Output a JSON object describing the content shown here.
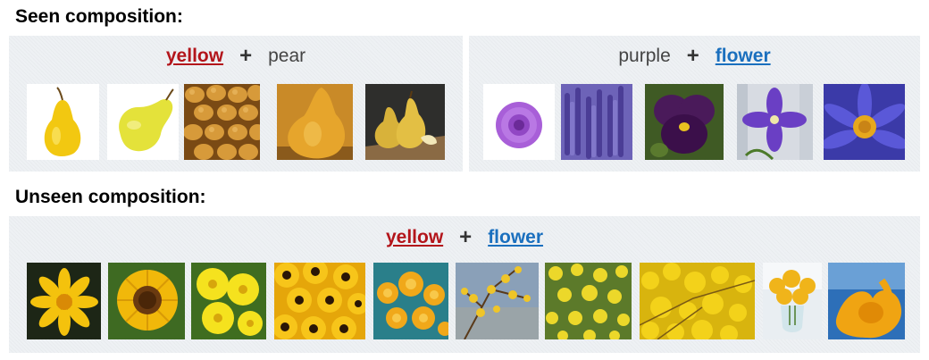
{
  "seen": {
    "title": "Seen composition:",
    "left": {
      "attribute": "yellow",
      "plus": "+",
      "object": "pear",
      "images": [
        "pear-image",
        "pear-image",
        "pear-image",
        "pear-image",
        "pear-image"
      ]
    },
    "right": {
      "attribute": "purple",
      "plus": "+",
      "object": "flower",
      "images": [
        "purple-flower-image",
        "purple-flower-image",
        "purple-flower-image",
        "purple-flower-image",
        "purple-flower-image"
      ]
    }
  },
  "unseen": {
    "title": "Unseen composition:",
    "attribute": "yellow",
    "plus": "+",
    "object": "flower",
    "images": [
      "yellow-flower-image",
      "yellow-flower-image",
      "yellow-flower-image",
      "yellow-flower-image",
      "yellow-flower-image",
      "yellow-flower-image",
      "yellow-flower-image",
      "yellow-flower-image",
      "yellow-flower-image",
      "yellow-flower-image"
    ]
  },
  "colors": {
    "attribute_red": "#b3151b",
    "object_blue": "#1a6fbe",
    "panel_bg": "#eef1f4"
  }
}
